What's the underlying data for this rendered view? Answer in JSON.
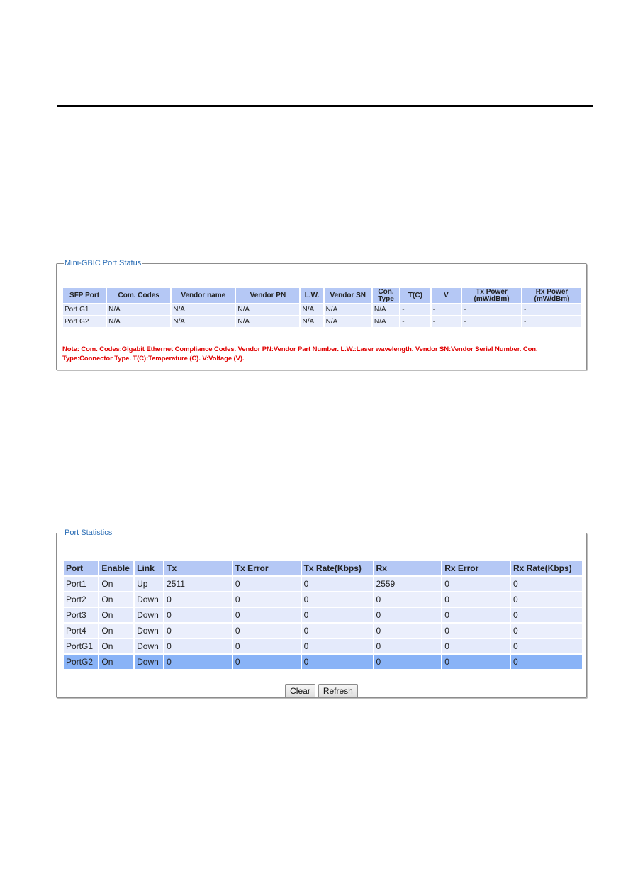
{
  "gbic_panel": {
    "title": "Mini-GBIC Port Status",
    "columns": [
      "SFP Port",
      "Com. Codes",
      "Vendor name",
      "Vendor PN",
      "L.W.",
      "Vendor SN",
      "Con.\nType",
      "T(C)",
      "V",
      "Tx Power\n(mW/dBm)",
      "Rx Power\n(mW/dBm)"
    ],
    "rows": [
      [
        "Port G1",
        "N/A",
        "N/A",
        "N/A",
        "N/A",
        "N/A",
        "N/A",
        "-",
        "-",
        "-",
        "-"
      ],
      [
        "Port G2",
        "N/A",
        "N/A",
        "N/A",
        "N/A",
        "N/A",
        "N/A",
        "-",
        "-",
        "-",
        "-"
      ]
    ],
    "note": "Note: Com. Codes:Gigabit Ethernet Compliance Codes.  Vendor PN:Vendor Part Number.  L.W.:Laser wavelength.  Vendor SN:Vendor Serial Number.  Con. Type:Connector Type.  T(C):Temperature (C).  V:Voltage (V)."
  },
  "stats_panel": {
    "title": "Port Statistics",
    "columns": [
      "Port",
      "Enable",
      "Link",
      "Tx",
      "Tx Error",
      "Tx Rate(Kbps)",
      "Rx",
      "Rx Error",
      "Rx Rate(Kbps)"
    ],
    "rows": [
      [
        "Port1",
        "On",
        "Up",
        "2511",
        "0",
        "0",
        "2559",
        "0",
        "0"
      ],
      [
        "Port2",
        "On",
        "Down",
        "0",
        "0",
        "0",
        "0",
        "0",
        "0"
      ],
      [
        "Port3",
        "On",
        "Down",
        "0",
        "0",
        "0",
        "0",
        "0",
        "0"
      ],
      [
        "Port4",
        "On",
        "Down",
        "0",
        "0",
        "0",
        "0",
        "0",
        "0"
      ],
      [
        "PortG1",
        "On",
        "Down",
        "0",
        "0",
        "0",
        "0",
        "0",
        "0"
      ],
      [
        "PortG2",
        "On",
        "Down",
        "0",
        "0",
        "0",
        "0",
        "0",
        "0"
      ]
    ],
    "selected_row": 5,
    "buttons": {
      "clear": "Clear",
      "refresh": "Refresh"
    }
  }
}
